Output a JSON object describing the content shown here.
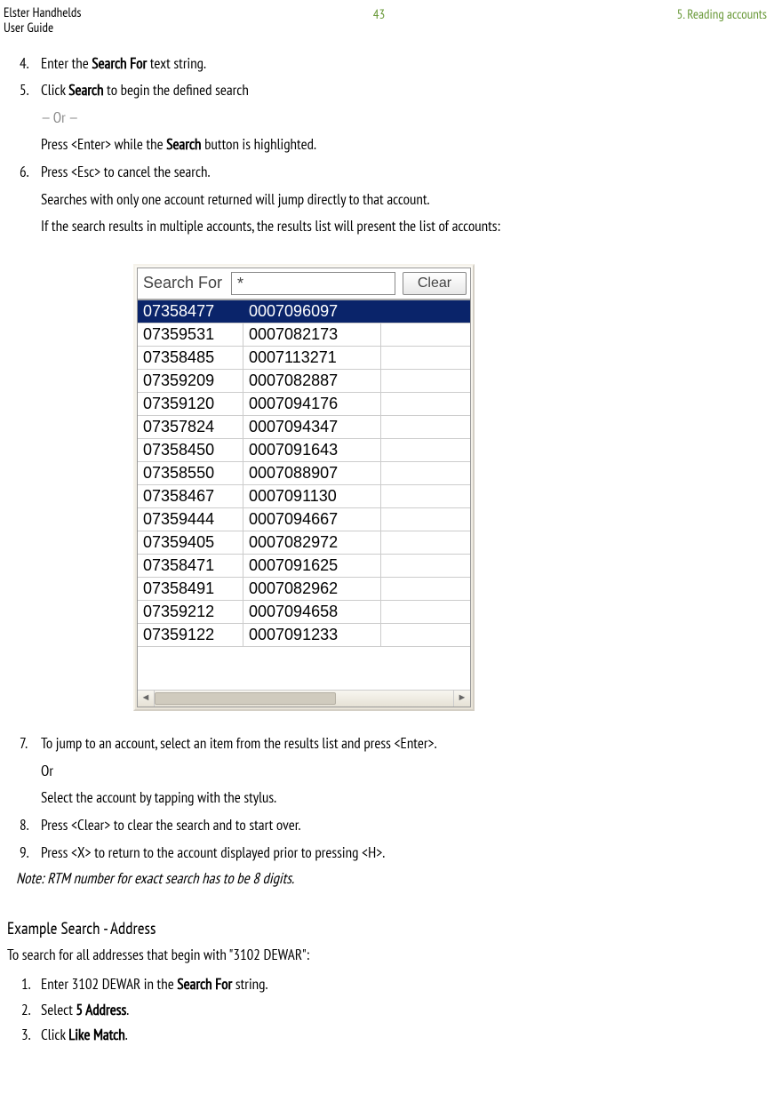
{
  "header": {
    "left": "Elster Handhelds\nUser Guide",
    "page_number": "43",
    "right": "5. Reading accounts"
  },
  "steps_first": {
    "s4": {
      "prefix": "Enter the ",
      "bold": "Search For",
      "suffix": " text string."
    },
    "s5": {
      "prefix": "Click ",
      "bold": "Search",
      "suffix": " to begin the defined search",
      "or": "— Or —",
      "p2a": "Press <Enter> while the ",
      "p2b": "Search",
      "p2c": " button is highlighted."
    },
    "s6": {
      "line1": "Press <Esc> to cancel the search.",
      "line2": "Searches with only one account returned will jump directly to that account.",
      "line3": "If the search results in multiple accounts, the results list will present the list of accounts:"
    }
  },
  "screenshot": {
    "label": "Search For",
    "field_value": "*",
    "clear_button": "Clear",
    "rows": [
      {
        "a": "07358477",
        "b": "0007096097",
        "selected": true
      },
      {
        "a": "07359531",
        "b": "0007082173"
      },
      {
        "a": "07358485",
        "b": "0007113271"
      },
      {
        "a": "07359209",
        "b": "0007082887"
      },
      {
        "a": "07359120",
        "b": "0007094176"
      },
      {
        "a": "07357824",
        "b": "0007094347"
      },
      {
        "a": "07358450",
        "b": "0007091643"
      },
      {
        "a": "07358550",
        "b": "0007088907"
      },
      {
        "a": "07358467",
        "b": "0007091130"
      },
      {
        "a": "07359444",
        "b": "0007094667"
      },
      {
        "a": "07359405",
        "b": "0007082972"
      },
      {
        "a": "07358471",
        "b": "0007091625"
      },
      {
        "a": "07358491",
        "b": "0007082962"
      },
      {
        "a": "07359212",
        "b": "0007094658"
      },
      {
        "a": "07359122",
        "b": "0007091233"
      }
    ]
  },
  "steps_second": {
    "s7": {
      "line1": "To jump to an account, select an item from the results list and press <Enter>.",
      "or": "Or",
      "line2": "Select the account by tapping with the stylus."
    },
    "s8": "Press <Clear> to clear the search and to start over.",
    "s9": "Press <X> to return to the account displayed prior to pressing <H>."
  },
  "note": "Note: RTM number for exact search has to be 8 digits.",
  "example": {
    "heading": "Example Search - Address",
    "intro": "To search for all addresses that begin with \"3102 DEWAR\":",
    "e1": {
      "prefix": "Enter 3102 DEWAR in the ",
      "bold": "Search For",
      "suffix": " string."
    },
    "e2": {
      "prefix": "Select ",
      "bold": "5 Address",
      "suffix": "."
    },
    "e3": {
      "prefix": "Click ",
      "bold": "Like Match",
      "suffix": "."
    }
  }
}
